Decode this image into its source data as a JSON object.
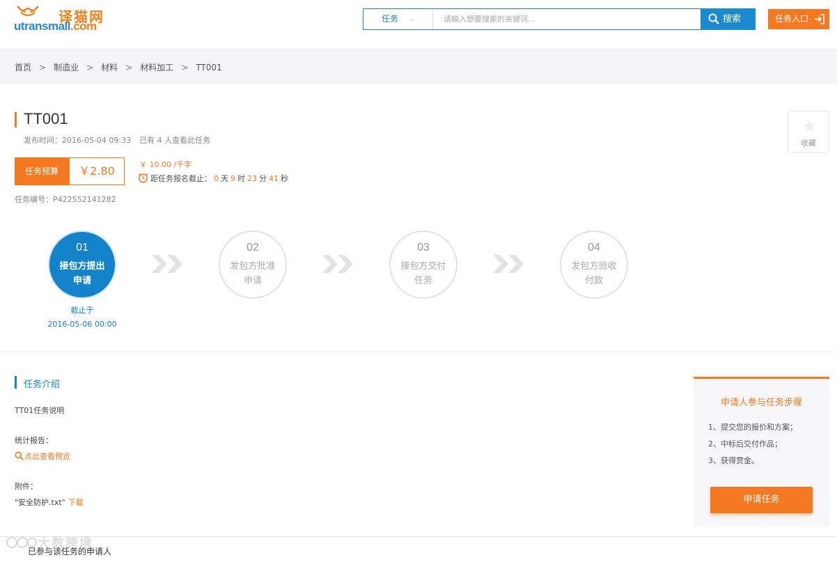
{
  "header": {
    "logo_cn": "译猫网",
    "logo_en_main": "utransmall",
    "logo_en_suffix": ".com",
    "search_type": "任务",
    "search_placeholder": "请输入想要搜索的关键词...",
    "search_button": "搜索",
    "entry_button": "任务入口"
  },
  "breadcrumb": [
    "首页",
    "制造业",
    "材料",
    "材料加工",
    "TT001"
  ],
  "breadcrumb_sep": ">",
  "task": {
    "title": "TT001",
    "publish_time": "发布时间：2016-05-04 09:33",
    "views": "已有 4 人查看此任务",
    "budget_label": "任务预算",
    "budget_value": "￥2.80",
    "unit_price": "￥ 10.00 /千字",
    "deadline_label": "距任务报名截止：",
    "countdown": {
      "days": "0",
      "days_unit": "天",
      "hours": "9",
      "hours_unit": "时",
      "minutes": "23",
      "minutes_unit": "分",
      "seconds": "41",
      "seconds_unit": "秒"
    },
    "task_no": "任务编号：P422552141282",
    "favorite": "收藏"
  },
  "steps": [
    {
      "num": "01",
      "label": "接包方提出申请",
      "active": true
    },
    {
      "num": "02",
      "label": "发包方批准申请",
      "active": false
    },
    {
      "num": "03",
      "label": "接包方交付任务",
      "active": false
    },
    {
      "num": "04",
      "label": "发包方验收付款",
      "active": false
    }
  ],
  "step_deadline": {
    "label": "截止于",
    "date": "2016-05-06 00:00"
  },
  "intro": {
    "title": "任务介绍",
    "description": "TT01任务说明",
    "stat_label": "统计报告：",
    "preview_link": "点此查看预览",
    "attach_label": "附件：",
    "attach_file": "\"安全防护.txt\"",
    "download": "下载"
  },
  "panel": {
    "title": "申请人参与任务步骤",
    "items": [
      "1、提交您的报价和方案；",
      "2、中标后交付作品；",
      "3、获得赏金。"
    ],
    "apply_button": "申请任务"
  },
  "bottom": {
    "applicants": "已参与该任务的申请人",
    "watermark": "大数跨境"
  },
  "colors": {
    "orange": "#f47920",
    "blue": "#1283c9"
  }
}
